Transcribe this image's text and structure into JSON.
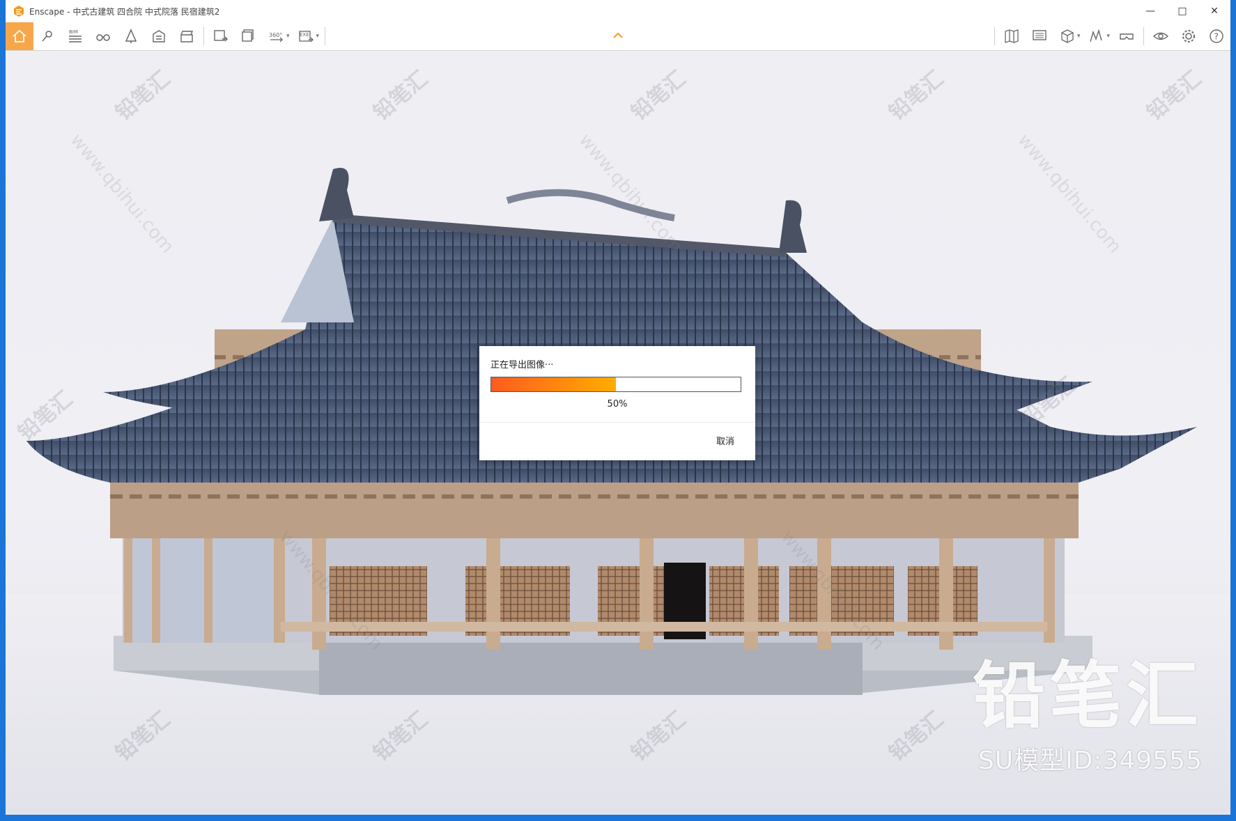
{
  "window": {
    "title": "Enscape - 中式古建筑 四合院 中式院落  民宿建筑2",
    "controls": {
      "minimize": "—",
      "maximize": "□",
      "close": "✕"
    }
  },
  "toolbar": {
    "active_color": "#f7a74a",
    "left_tools": [
      "home-icon",
      "pin-icon",
      "bim-icon",
      "binoculars-icon",
      "tree-icon",
      "building-icon",
      "clapper-icon"
    ],
    "bim_label": "BIM",
    "export_tools": [
      "export-image-icon",
      "batch-export-icon",
      "panorama-icon",
      "exe-export-icon"
    ],
    "panorama_label": "360°",
    "exe_label": "EXE",
    "right_tools": [
      "map-icon",
      "monitor-icon",
      "cube-icon",
      "chart-icon",
      "vr-icon",
      "eye-icon",
      "gear-icon",
      "help-icon"
    ],
    "help_label": "?"
  },
  "dialog": {
    "title": "正在导出图像···",
    "progress": 0.5,
    "progress_text": "50%",
    "cancel": "取消",
    "progress_color_start": "#ff5a1f",
    "progress_color_end": "#ffad00"
  },
  "watermark": {
    "brand": "铅笔汇",
    "url": "www.qbihui.com",
    "brand_large": "铅笔汇",
    "model_id": "SU模型ID:349555"
  }
}
